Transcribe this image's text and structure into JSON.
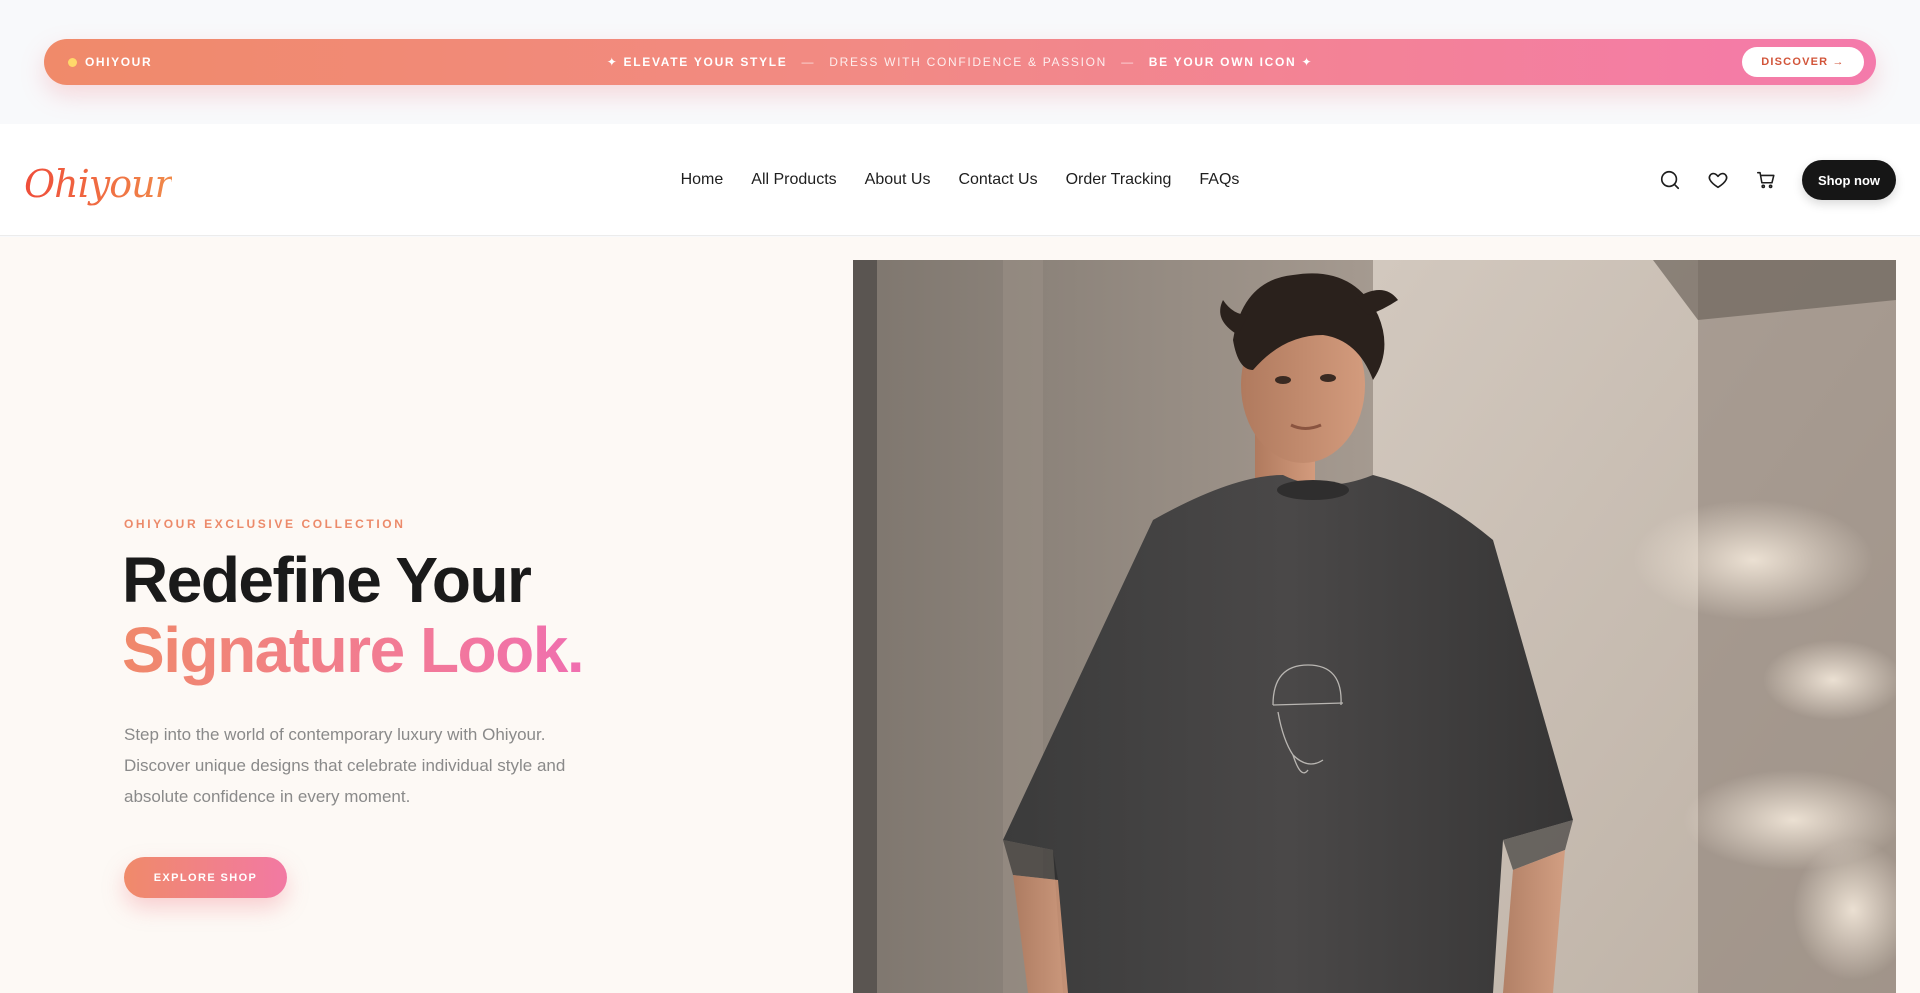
{
  "promo": {
    "brand": "OHIYOUR",
    "msg1": "✦ ELEVATE YOUR STYLE",
    "sep1": "—",
    "msg2": "DRESS WITH CONFIDENCE & PASSION",
    "sep2": "—",
    "msg3": "BE YOUR OWN ICON ✦",
    "discover_label": "DISCOVER →"
  },
  "header": {
    "logo": "Ohiyour",
    "nav": [
      "Home",
      "All Products",
      "About Us",
      "Contact Us",
      "Order Tracking",
      "FAQs"
    ],
    "icons": [
      "search-icon",
      "heart-icon",
      "cart-icon"
    ],
    "shop_now_label": "Shop now"
  },
  "hero": {
    "eyebrow": "OHIYOUR EXCLUSIVE COLLECTION",
    "headline_line1": "Redefine Your",
    "headline_line2": "Signature Look.",
    "description": "Step into the world of contemporary luxury with Ohiyour. Discover unique designs that celebrate individual style and absolute confidence in every moment.",
    "cta_label": "EXPLORE SHOP"
  },
  "colors": {
    "accent_start": "#f08a6a",
    "accent_end": "#f47aab",
    "logo": "#ea5a3a",
    "dark": "#161616",
    "hero_bg": "#fdf9f5"
  }
}
